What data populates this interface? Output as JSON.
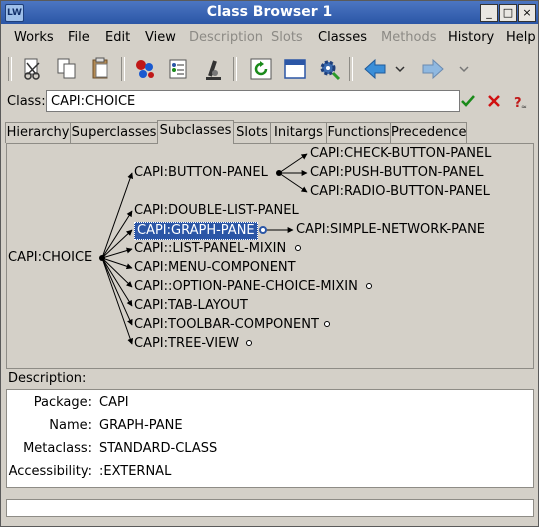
{
  "window": {
    "title": "Class Browser 1",
    "icon_text": "LW",
    "controls": [
      "_",
      "□",
      "×"
    ]
  },
  "menu": [
    "Works",
    "File",
    "Edit",
    "View",
    "Description",
    "Slots",
    "Classes",
    "Methods",
    "History",
    "Help"
  ],
  "menu_disabled": [
    "Description",
    "Slots",
    "Methods"
  ],
  "class_row": {
    "label": "Class:",
    "value": "CAPI:CHOICE"
  },
  "tabs": [
    "Hierarchy",
    "Superclasses",
    "Subclasses",
    "Slots",
    "Initargs",
    "Functions",
    "Precedence"
  ],
  "active_tab": "Subclasses",
  "graph": {
    "root": "CAPI:CHOICE",
    "children": [
      "CAPI:BUTTON-PANEL",
      "CAPI:DOUBLE-LIST-PANEL",
      "CAPI:GRAPH-PANE",
      "CAPI::LIST-PANEL-MIXIN",
      "CAPI:MENU-COMPONENT",
      "CAPI::OPTION-PANE-CHOICE-MIXIN",
      "CAPI:TAB-LAYOUT",
      "CAPI:TOOLBAR-COMPONENT",
      "CAPI:TREE-VIEW"
    ],
    "button_panel_children": [
      "CAPI:CHECK-BUTTON-PANEL",
      "CAPI:PUSH-BUTTON-PANEL",
      "CAPI:RADIO-BUTTON-PANEL"
    ],
    "graph_pane_children": [
      "CAPI:SIMPLE-NETWORK-PANE"
    ],
    "selected": "CAPI:GRAPH-PANE"
  },
  "description": {
    "label": "Description:",
    "rows": [
      {
        "key": "Package:",
        "value": "CAPI"
      },
      {
        "key": "Name:",
        "value": "GRAPH-PANE"
      },
      {
        "key": "Metaclass:",
        "value": "STANDARD-CLASS"
      },
      {
        "key": "Accessibility:",
        "value": ":EXTERNAL"
      }
    ]
  },
  "colors": {
    "titlebar": "#2b56a6",
    "selection": "#2b56a6",
    "ok": "#1a8a1a",
    "cancel": "#d01010"
  },
  "toolbar_icons": [
    "cut-icon",
    "copy-icon",
    "paste-icon",
    "inspect-icon",
    "describe-icon",
    "microscope-icon",
    "refresh-icon",
    "window-icon",
    "gear-icon",
    "back-arrow-icon",
    "back-history-icon",
    "forward-arrow-icon",
    "forward-history-icon"
  ]
}
